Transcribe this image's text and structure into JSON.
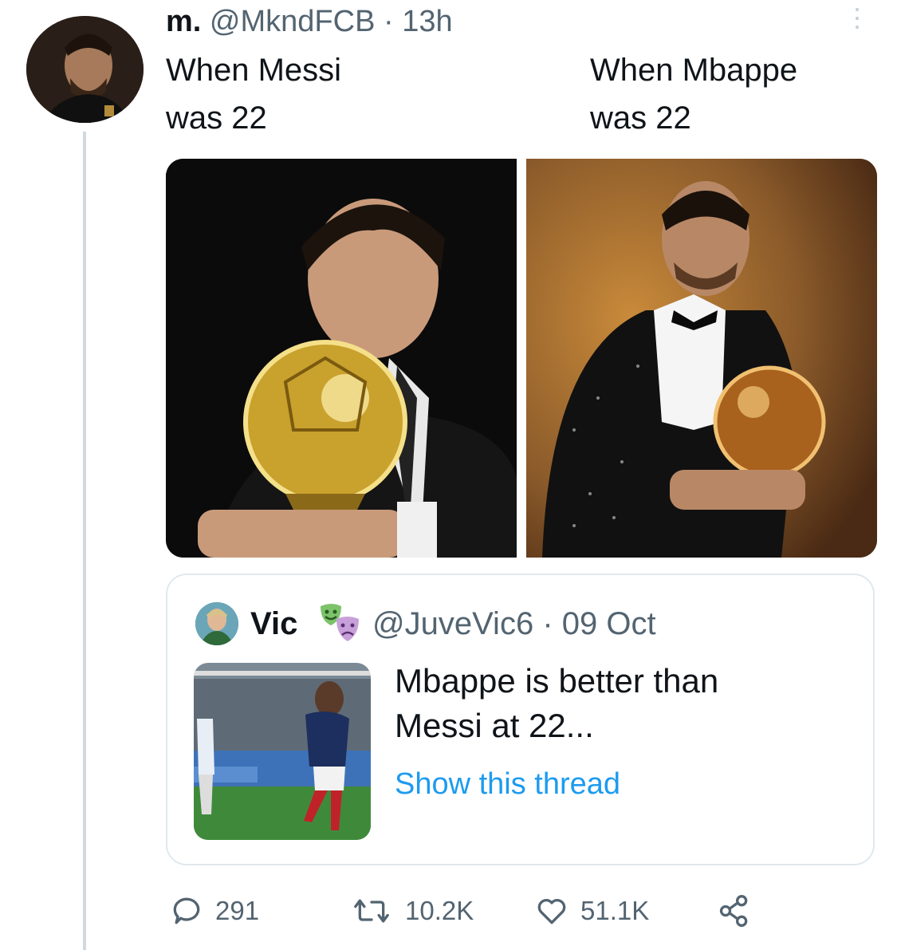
{
  "tweet": {
    "display_name": "m.",
    "handle": "@MkndFCB",
    "separator": "·",
    "time": "13h",
    "left_caption": "When Messi\nwas 22",
    "right_caption": "When Mbappe\nwas 22",
    "more_icon": "more-vertical-icon"
  },
  "quoted": {
    "name": "Vic",
    "badge_icon": "theater-masks-emoji",
    "handle": "@JuveVic6",
    "separator": "·",
    "date": "09 Oct",
    "text": "Mbappe is better than\nMessi at 22...",
    "link": "Show this thread"
  },
  "actions": {
    "replies": "291",
    "retweets": "10.2K",
    "likes": "51.1K"
  },
  "colors": {
    "link": "#1d9bf0",
    "meta": "#536471",
    "border": "#e1e8ed"
  }
}
